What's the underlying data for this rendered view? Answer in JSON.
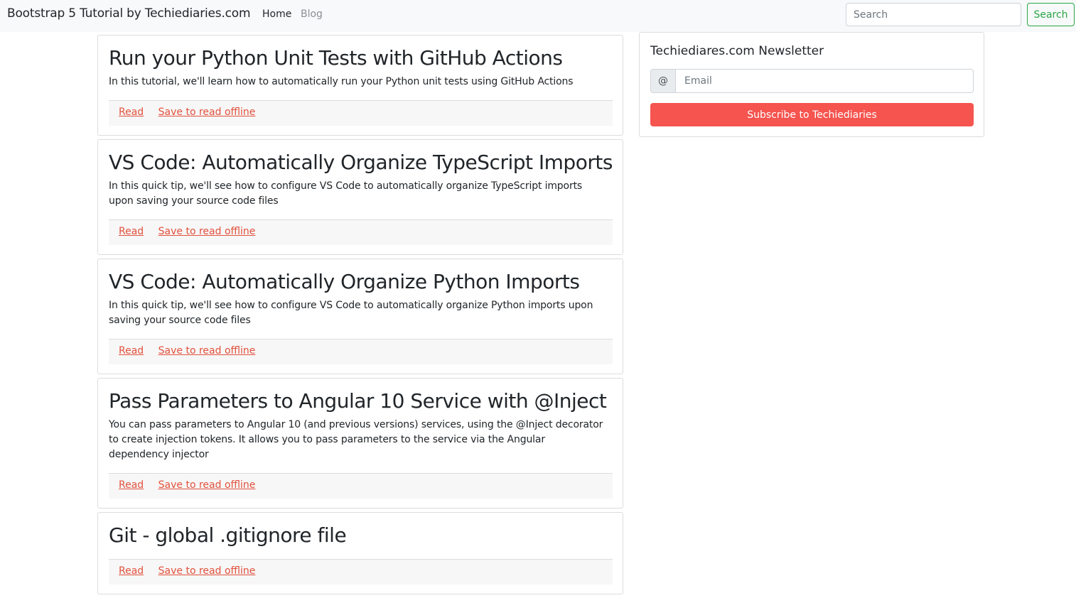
{
  "navbar": {
    "brand": "Bootstrap 5 Tutorial by Techiediaries.com",
    "links": [
      {
        "label": "Home",
        "active": true
      },
      {
        "label": "Blog",
        "active": false
      }
    ],
    "search_placeholder": "Search",
    "search_button": "Search"
  },
  "posts": [
    {
      "title": "Run your Python Unit Tests with GitHub Actions",
      "excerpt": "In this tutorial, we'll learn how to automatically run your Python unit tests using GitHub Actions",
      "read_label": "Read",
      "save_label": "Save to read offline"
    },
    {
      "title": "VS Code: Automatically Organize TypeScript Imports",
      "excerpt": "In this quick tip, we'll see how to configure VS Code to automatically organize TypeScript imports upon saving your source code files",
      "read_label": "Read",
      "save_label": "Save to read offline"
    },
    {
      "title": "VS Code: Automatically Organize Python Imports",
      "excerpt": "In this quick tip, we'll see how to configure VS Code to automatically organize Python imports upon saving your source code files",
      "read_label": "Read",
      "save_label": "Save to read offline"
    },
    {
      "title": "Pass Parameters to Angular 10 Service with @Inject",
      "excerpt": "You can pass parameters to Angular 10 (and previous versions) services, using the @Inject decorator to create injection tokens. It allows you to pass parameters to the service via the Angular dependency injector",
      "read_label": "Read",
      "save_label": "Save to read offline"
    },
    {
      "title": "Git - global .gitignore file",
      "excerpt": "",
      "read_label": "Read",
      "save_label": "Save to read offline"
    }
  ],
  "newsletter": {
    "title": "Techiediares.com Newsletter",
    "addon": "@",
    "email_placeholder": "Email",
    "subscribe_label": "Subscribe to Techiediaries"
  },
  "colors": {
    "navbar_bg": "#f8f9fa",
    "success": "#28a745",
    "link": "#e2513d",
    "subscribe_bg": "#f5544f"
  }
}
